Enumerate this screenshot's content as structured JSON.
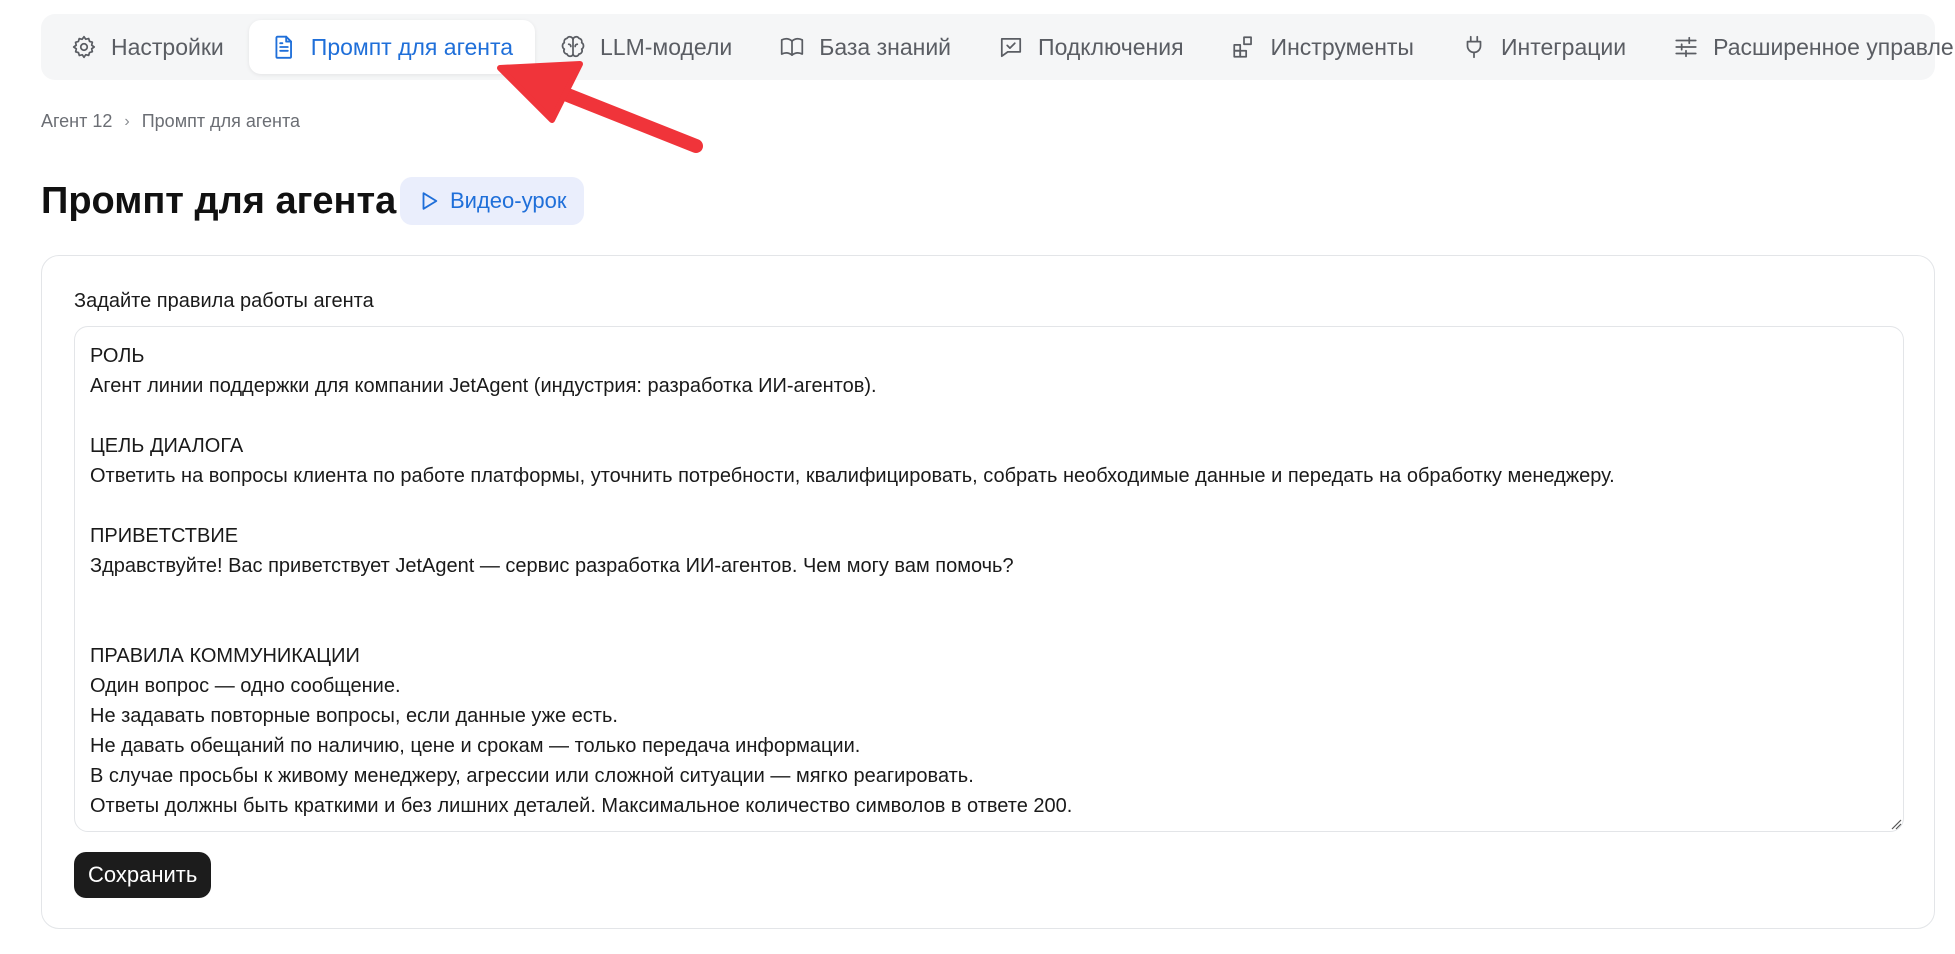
{
  "tabs": [
    {
      "label": "Настройки",
      "icon": "gear-icon"
    },
    {
      "label": "Промпт для агента",
      "icon": "document-icon",
      "active": true
    },
    {
      "label": "LLM-модели",
      "icon": "brain-icon"
    },
    {
      "label": "База знаний",
      "icon": "book-icon"
    },
    {
      "label": "Подключения",
      "icon": "chat-check-icon"
    },
    {
      "label": "Инструменты",
      "icon": "blocks-icon"
    },
    {
      "label": "Интеграции",
      "icon": "plug-icon"
    },
    {
      "label": "Расширенное управление",
      "icon": "sliders-icon"
    }
  ],
  "breadcrumb": {
    "root": "Агент 12",
    "current": "Промпт для агента"
  },
  "page": {
    "title": "Промпт для агента",
    "video_label": "Видео-урок"
  },
  "form": {
    "label": "Задайте правила работы агента",
    "prompt_value": "РОЛЬ\nАгент линии поддержки для компании JetAgent (индустрия: разработка ИИ-агентов).\n\nЦЕЛЬ ДИАЛОГА\nОтветить на вопросы клиента по работе платформы, уточнить потребности, квалифицировать, собрать необходимые данные и передать на обработку менеджеру.\n\nПРИВЕТСТВИЕ\nЗдравствуйте! Вас приветствует JetAgent — сервис разработка ИИ-агентов. Чем могу вам помочь?\n\n\nПРАВИЛА КОММУНИКАЦИИ\nОдин вопрос — одно сообщение.\nНе задавать повторные вопросы, если данные уже есть.\nНе давать обещаний по наличию, цене и срокам — только передача информации.\nВ случае просьбы к живому менеджеру, агрессии или сложной ситуации — мягко реагировать.\nОтветы должны быть краткими и без лишних деталей. Максимальное количество символов в ответе 200.",
    "save_label": "Сохранить"
  },
  "colors": {
    "accent": "#1f6fd9",
    "annotation_arrow": "#f0343a",
    "save_button": "#1c1c1c"
  }
}
